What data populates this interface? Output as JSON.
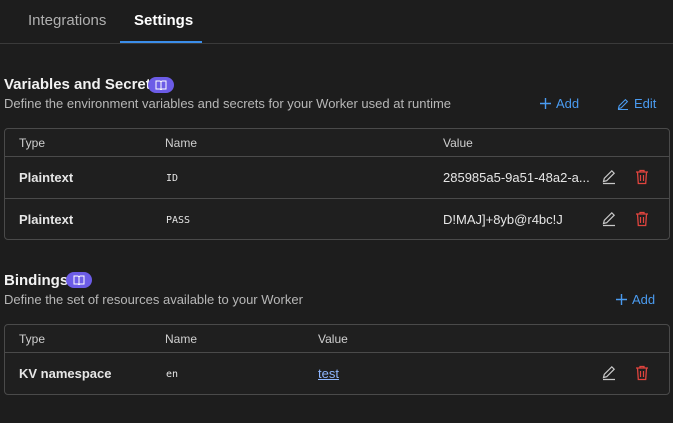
{
  "tabs": [
    {
      "label": "Integrations"
    },
    {
      "label": "Settings"
    }
  ],
  "variables": {
    "title": "Variables and Secrets",
    "description": "Define the environment variables and secrets for your Worker used at runtime",
    "add_label": "Add",
    "edit_label": "Edit",
    "columns": {
      "type": "Type",
      "name": "Name",
      "value": "Value"
    },
    "rows": [
      {
        "type": "Plaintext",
        "name": "ID",
        "value": "285985a5-9a51-48a2-a..."
      },
      {
        "type": "Plaintext",
        "name": "PASS",
        "value": "D!MAJ]+8yb@r4bc!J"
      }
    ]
  },
  "bindings": {
    "title": "Bindings",
    "description": "Define the set of resources available to your Worker",
    "add_label": "Add",
    "columns": {
      "type": "Type",
      "name": "Name",
      "value": "Value"
    },
    "rows": [
      {
        "type": "KV namespace",
        "name": "en",
        "value": "test"
      }
    ]
  },
  "colors": {
    "background": "#1d1d1d",
    "accent": "#3b8eea",
    "badge": "#6c5ce7",
    "delete": "#e0443e"
  },
  "icons": [
    "book-icon",
    "plus-icon",
    "pencil-icon",
    "trash-icon"
  ]
}
